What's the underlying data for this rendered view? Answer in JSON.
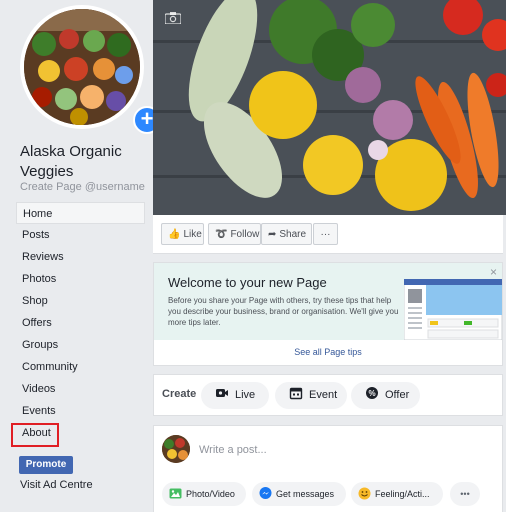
{
  "page": {
    "name": "Alaska Organic Veggies",
    "username": "Create Page @username"
  },
  "nav": {
    "items": [
      "Home",
      "Posts",
      "Reviews",
      "Photos",
      "Shop",
      "Offers",
      "Groups",
      "Community",
      "Videos",
      "Events",
      "About"
    ],
    "active": "Home",
    "highlighted": "About"
  },
  "promote_label": "Promote",
  "visit_ad_centre": "Visit Ad Centre",
  "actions": {
    "like": "Like",
    "follow": "Follow",
    "share": "Share",
    "more": "···"
  },
  "welcome": {
    "title": "Welcome to your new Page",
    "body": "Before you share your Page with others, try these tips that help you describe your business, brand or organisation. We'll give you more tips later.",
    "close": "×",
    "link": "See all Page tips"
  },
  "create": {
    "label": "Create",
    "live": "Live",
    "event": "Event",
    "offer": "Offer"
  },
  "post": {
    "placeholder": "Write a post...",
    "photo_video": "Photo/Video",
    "get_messages": "Get messages",
    "feeling": "Feeling/Acti...",
    "more": "•••"
  },
  "colors": {
    "accent_blue": "#4267b2",
    "highlight_red": "#e01e24",
    "welcome_bg": "#e7f3f1"
  }
}
